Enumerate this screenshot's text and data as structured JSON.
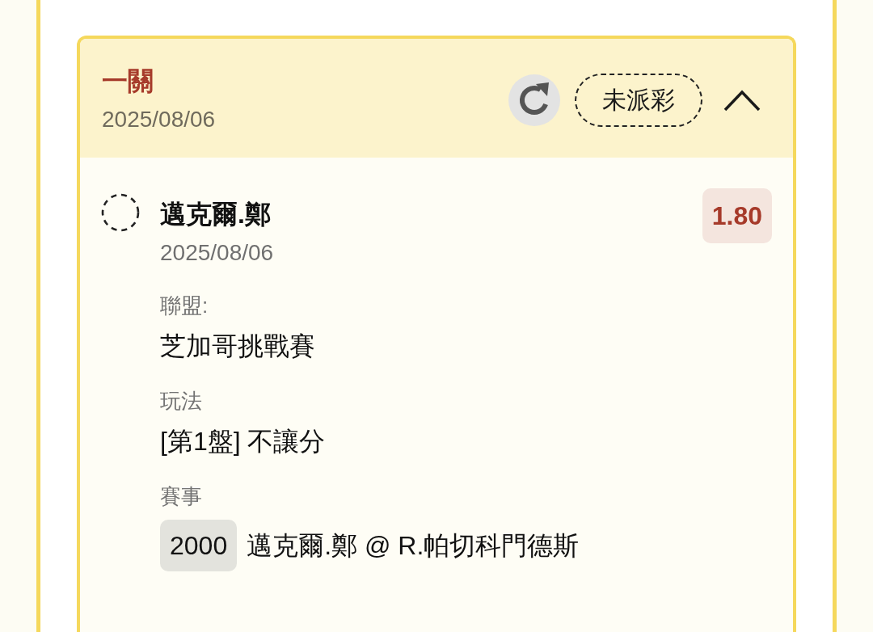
{
  "bet": {
    "type": "一關",
    "date": "2025/08/06",
    "status": "未派彩",
    "expanded": true,
    "selections": [
      {
        "name": "邁克爾.鄭",
        "date": "2025/08/06",
        "odds": "1.80",
        "fields": [
          {
            "label": "聯盟:",
            "value": "芝加哥挑戰賽"
          },
          {
            "label": "玩法",
            "value": "[第1盤] 不讓分"
          },
          {
            "label": "賽事",
            "code": "2000",
            "value": "邁克爾.鄭 @ R.帕切科門德斯"
          }
        ]
      }
    ]
  }
}
